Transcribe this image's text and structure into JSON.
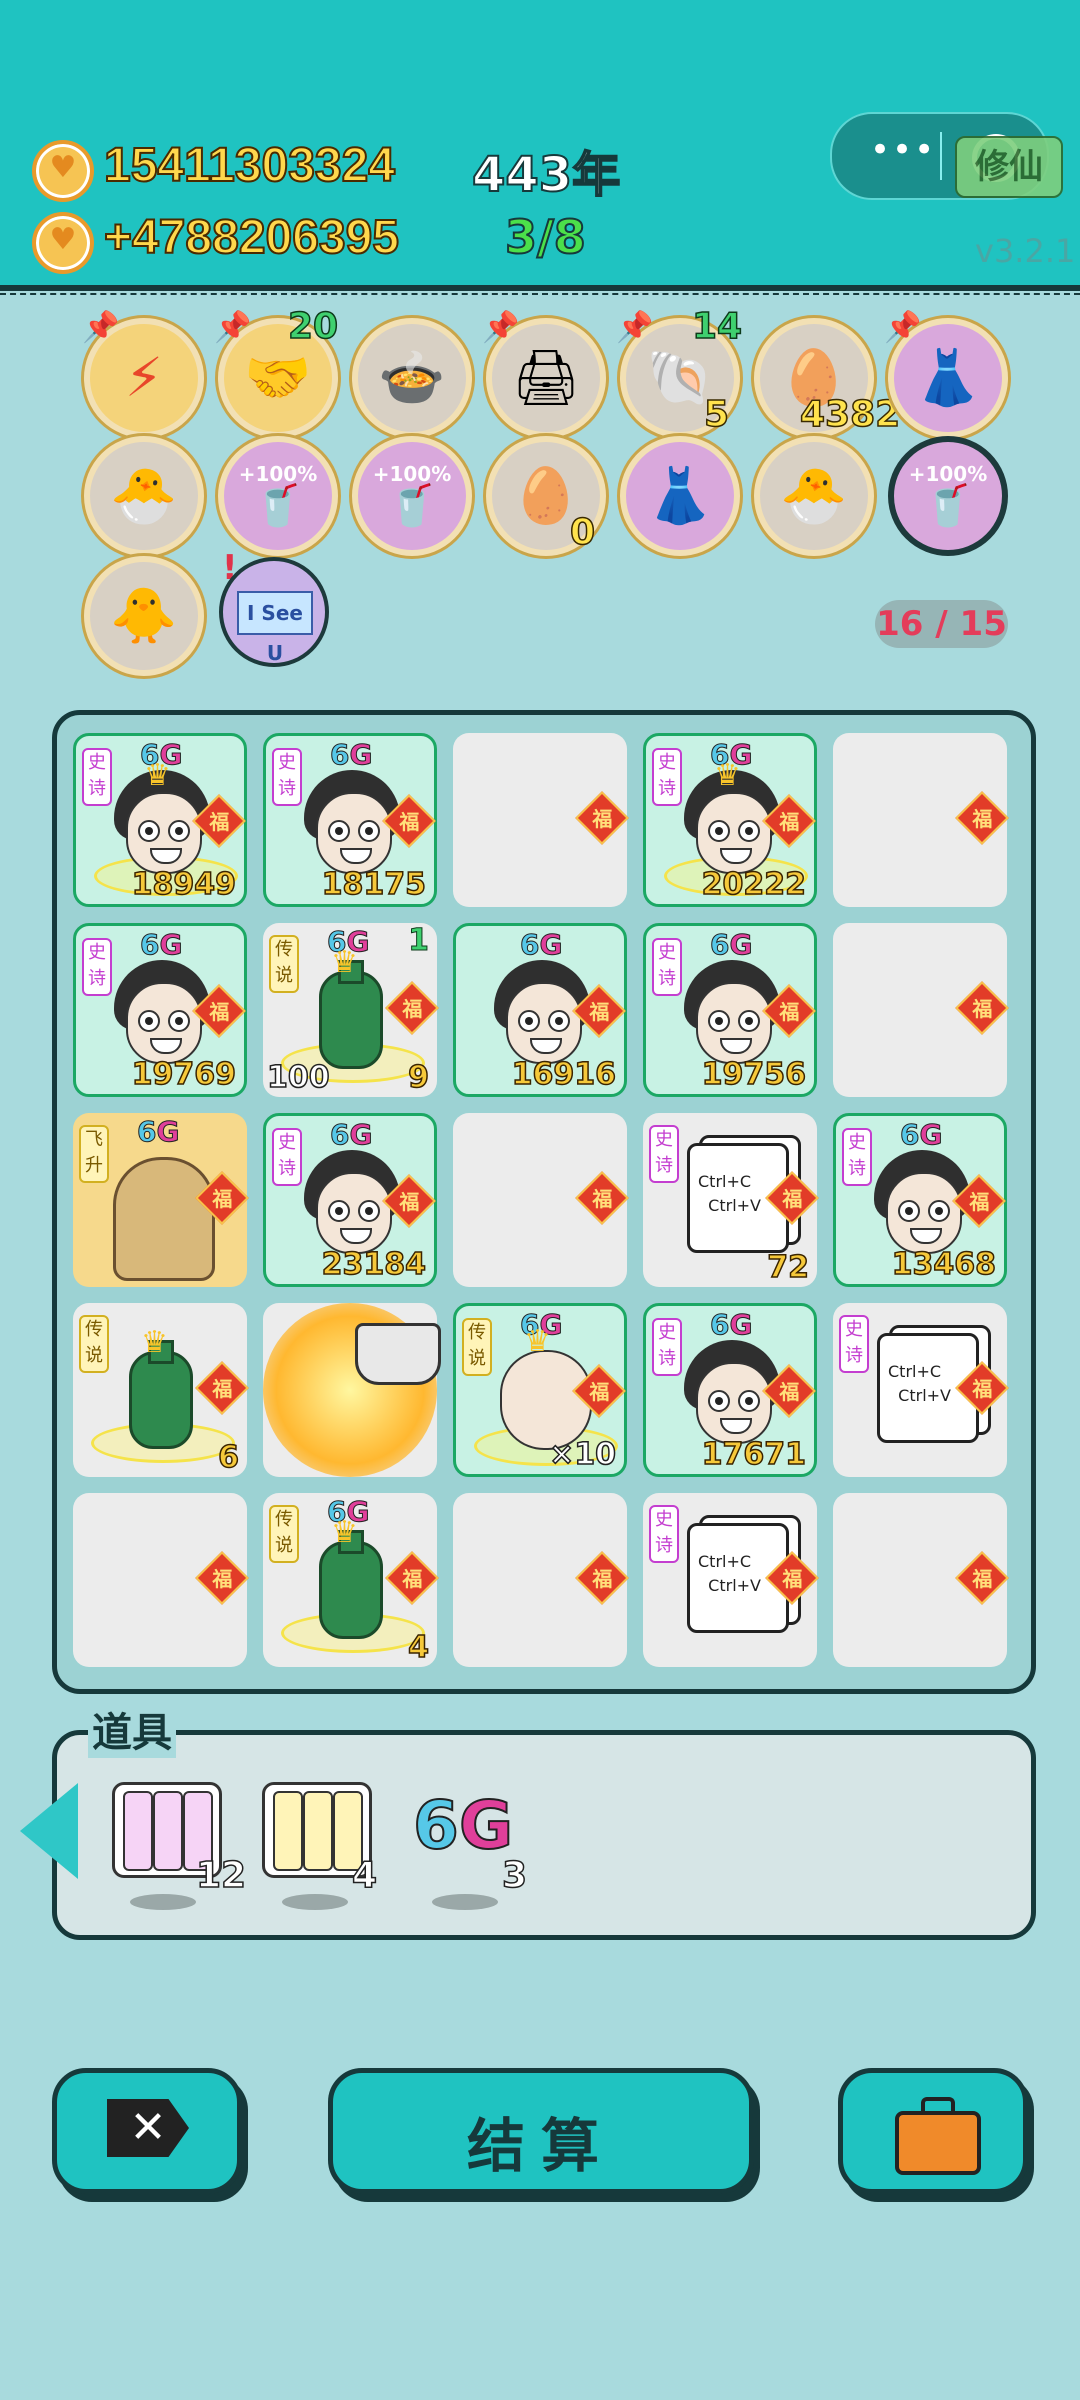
{
  "header": {
    "coins": "15411303324",
    "income": "+4788206395",
    "years": "443年",
    "progress": "3/8",
    "version": "v3.2.1",
    "badge": "修仙"
  },
  "buffs": [
    {
      "icon": "lightning-icon",
      "num": ""
    },
    {
      "icon": "handshake-icon",
      "num": "20"
    },
    {
      "icon": "pot-duck-icon",
      "num": ""
    },
    {
      "icon": "printer-icon",
      "num": ""
    },
    {
      "icon": "shell-icon",
      "num": "14",
      "num2": "5"
    },
    {
      "icon": "egg-tray-icon",
      "num": "4382"
    },
    {
      "icon": "skirt-icon",
      "num": ""
    },
    {
      "icon": "chick-icon",
      "num": ""
    },
    {
      "icon": "tea-cup-icon",
      "pct": "+100%"
    },
    {
      "icon": "tea-cup-icon",
      "pct": "+100%"
    },
    {
      "icon": "egg-tray-icon",
      "num": "0"
    },
    {
      "icon": "skirt-icon",
      "num": ""
    },
    {
      "icon": "chick-icon",
      "num": ""
    },
    {
      "icon": "tea-cup-icon",
      "pct": "+100%"
    },
    {
      "icon": "zombie-chick-icon",
      "num": ""
    },
    {
      "icon": "i-see-u-icon",
      "label": "I See U"
    }
  ],
  "slot_count": "16 / 15",
  "board": {
    "fu": "福",
    "tag_epic": "史诗",
    "tag_legend": "传说",
    "tag_rise": "飞升",
    "g6": "6",
    "g6b": "G",
    "values": {
      "r1c1": "18949",
      "r1c2": "18175",
      "r1c4": "20222",
      "r2c1": "19769",
      "r2c2_top": "1",
      "r2c2_left": "100",
      "r2c2_right": "9",
      "r2c3": "16916",
      "r2c4": "19756",
      "r3c2": "23184",
      "r3c4": "72",
      "r3c5": "13468",
      "r4c1": "6",
      "r4c3": "×10",
      "r4c4": "17671",
      "r5c2": "4"
    },
    "ctrl_text": "Ctrl+C\n  Ctrl+V"
  },
  "props": {
    "title": "道具",
    "items": [
      {
        "icon": "epic-pack-icon",
        "count": "12"
      },
      {
        "icon": "legend-pack-icon",
        "count": "4"
      },
      {
        "icon": "6g-icon",
        "count": "3"
      }
    ],
    "g6": "6",
    "g6b": "G"
  },
  "buttons": {
    "exit": "✕",
    "settle": "结算"
  }
}
